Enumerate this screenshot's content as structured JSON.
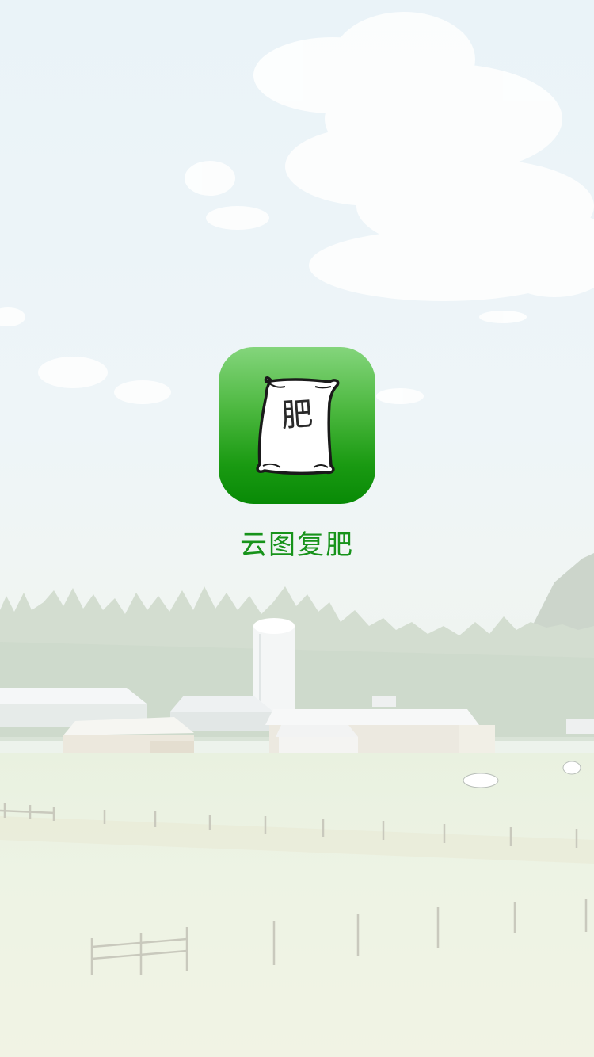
{
  "splash": {
    "app_name": "云图复肥",
    "icon": {
      "name": "fertilizer-bag-icon",
      "bag_text": "肥"
    },
    "background": {
      "name": "farm-landscape-illustration"
    }
  },
  "colors": {
    "brand_green": "#17931a",
    "icon_gradient_top": "#84d57c",
    "icon_gradient_bottom": "#088a06",
    "sky": "#eaf3f8",
    "field": "#eef4e6"
  }
}
